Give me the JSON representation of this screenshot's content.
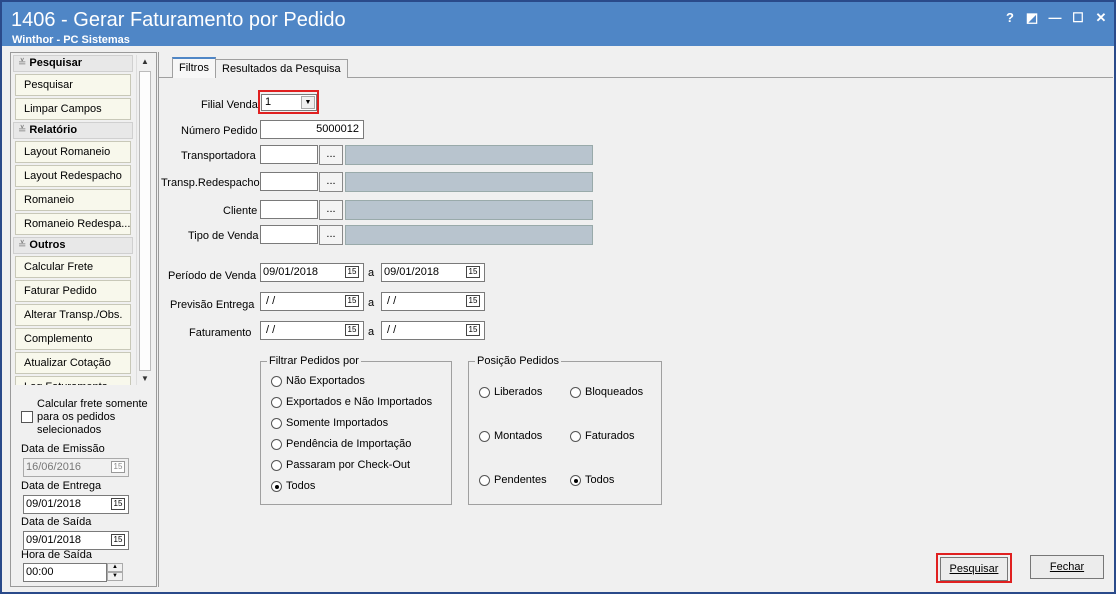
{
  "window": {
    "title": "1406 - Gerar Faturamento por Pedido",
    "subtitle": "Winthor - PC Sistemas",
    "controls": [
      "?",
      "◩",
      "—",
      "☐",
      "✕"
    ]
  },
  "sidebar": {
    "sections": [
      {
        "header": "Pesquisar",
        "items": [
          "Pesquisar",
          "Limpar Campos"
        ]
      },
      {
        "header": "Relatório",
        "items": [
          "Layout Romaneio",
          "Layout Redespacho",
          "Romaneio",
          "Romaneio Redespa..."
        ]
      },
      {
        "header": "Outros",
        "items": [
          "Calcular Frete",
          "Faturar Pedido",
          "Alterar Transp./Obs.",
          "Complemento",
          "Atualizar Cotação",
          "Log Faturamento"
        ]
      }
    ],
    "calc_frete_label": "Calcular frete somente para os pedidos selecionados",
    "data_emissao_label": "Data de Emissão",
    "data_emissao_value": "16/06/2016",
    "data_entrega_label": "Data de Entrega",
    "data_entrega_value": "09/01/2018",
    "data_saida_label": "Data de Saída",
    "data_saida_value": "09/01/2018",
    "hora_saida_label": "Hora de Saída",
    "hora_saida_value": "00:00"
  },
  "tabs": [
    "Filtros",
    "Resultados da Pesquisa"
  ],
  "filtros": {
    "filial_label": "Filial Venda",
    "filial_value": "1",
    "numero_pedido_label": "Número Pedido",
    "numero_pedido_value": "5000012",
    "transportadora_label": "Transportadora",
    "transp_redespacho_label": "Transp.Redespacho",
    "cliente_label": "Cliente",
    "tipo_venda_label": "Tipo de Venda",
    "ellipsis": "...",
    "periodo_venda_label": "Período de Venda",
    "periodo_venda_from": "09/01/2018",
    "periodo_venda_to": "09/01/2018",
    "previsao_entrega_label": "Previsão Entrega",
    "previsao_from": " / /",
    "previsao_to": " / /",
    "faturamento_label": "Faturamento",
    "faturamento_from": " / /",
    "faturamento_to": " / /",
    "range_sep": "a",
    "cal_glyph": "15"
  },
  "filtrar_pedidos": {
    "title": "Filtrar Pedidos por",
    "options": [
      "Não Exportados",
      "Exportados e Não Importados",
      "Somente Importados",
      "Pendência de Importação",
      "Passaram por Check-Out",
      "Todos"
    ],
    "selected": "Todos"
  },
  "posicao_pedidos": {
    "title": "Posição Pedidos",
    "options": [
      "Liberados",
      "Bloqueados",
      "Montados",
      "Faturados",
      "Pendentes",
      "Todos"
    ],
    "selected": "Todos"
  },
  "buttons": {
    "pesquisar": "Pesquisar",
    "fechar": "Fechar"
  },
  "colors": {
    "titlebar": "#4f86c6",
    "highlight": "#e02020",
    "readonly_field": "#b8c4ce"
  }
}
